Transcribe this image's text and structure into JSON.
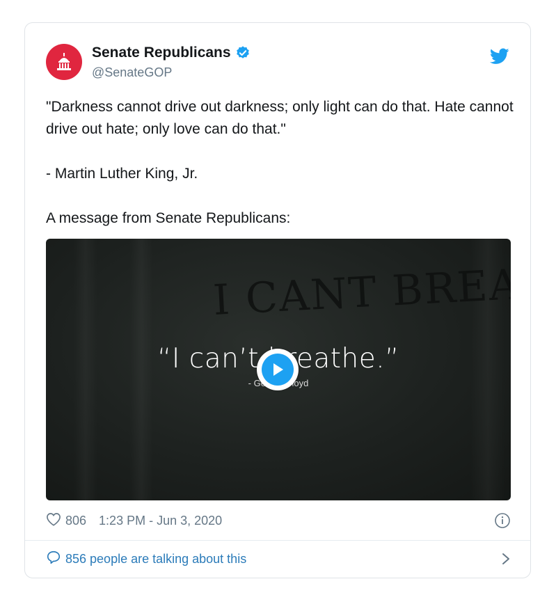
{
  "account": {
    "name": "Senate Republicans",
    "handle": "@SenateGOP"
  },
  "tweet": {
    "line1": "\"Darkness cannot drive out darkness; only light can do that. Hate cannot drive out hate; only love can do that.\"",
    "line2": "- Martin Luther King, Jr.",
    "line3": "A message from Senate Republicans:"
  },
  "video": {
    "graffiti": "I CANT BREATH",
    "quote": "“I can’t breathe.”",
    "attribution": "- George Floyd"
  },
  "meta": {
    "likes": "806",
    "timestamp": "1:23 PM - Jun 3, 2020"
  },
  "footer": {
    "talking": "856 people are talking about this"
  },
  "colors": {
    "avatar": "#e0263f",
    "twitter_blue": "#1da1f2",
    "link": "#2b7bb9",
    "muted": "#657786"
  },
  "icons": [
    "capitol-icon",
    "verified-badge-icon",
    "twitter-bird-icon",
    "play-icon",
    "heart-icon",
    "info-icon",
    "speech-bubble-icon",
    "chevron-right-icon"
  ]
}
